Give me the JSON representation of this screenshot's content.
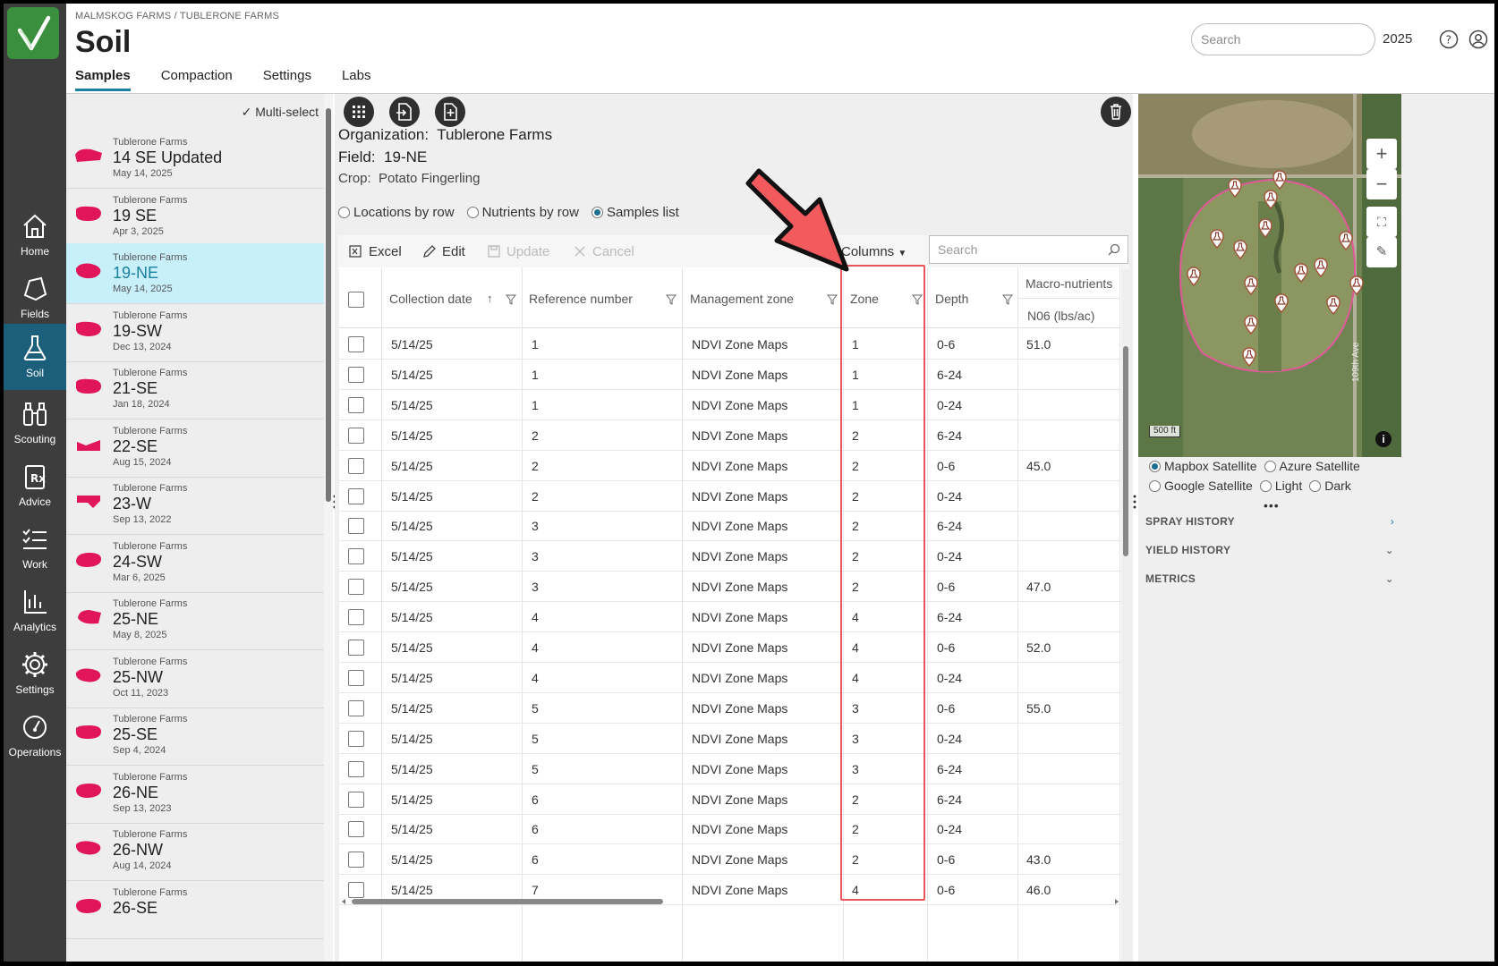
{
  "breadcrumb": "MALMSKOG FARMS / TUBLERONE FARMS",
  "page_title": "Soil",
  "tabs": [
    "Samples",
    "Compaction",
    "Settings",
    "Labs"
  ],
  "header": {
    "search_placeholder": "Search",
    "year": "2025"
  },
  "nav": [
    {
      "label": "Home",
      "icon": "home-icon"
    },
    {
      "label": "Fields",
      "icon": "fields-icon"
    },
    {
      "label": "Soil",
      "icon": "flask-icon"
    },
    {
      "label": "Scouting",
      "icon": "binoculars-icon"
    },
    {
      "label": "Advice",
      "icon": "rx-icon"
    },
    {
      "label": "Work",
      "icon": "checklist-icon"
    },
    {
      "label": "Analytics",
      "icon": "chart-icon"
    },
    {
      "label": "Settings",
      "icon": "gear-icon"
    },
    {
      "label": "Operations",
      "icon": "gauge-icon"
    }
  ],
  "list": {
    "multi_select_label": "Multi-select",
    "items": [
      {
        "org": "Tublerone Farms",
        "name": "14 SE Updated",
        "date": "May 14, 2025"
      },
      {
        "org": "Tublerone Farms",
        "name": "19 SE",
        "date": "Apr 3, 2025"
      },
      {
        "org": "Tublerone Farms",
        "name": "19-NE",
        "date": "May 14, 2025"
      },
      {
        "org": "Tublerone Farms",
        "name": "19-SW",
        "date": "Dec 13, 2024"
      },
      {
        "org": "Tublerone Farms",
        "name": "21-SE",
        "date": "Jan 18, 2024"
      },
      {
        "org": "Tublerone Farms",
        "name": "22-SE",
        "date": "Aug 15, 2024"
      },
      {
        "org": "Tublerone Farms",
        "name": "23-W",
        "date": "Sep 13, 2022"
      },
      {
        "org": "Tublerone Farms",
        "name": "24-SW",
        "date": "Mar 6, 2025"
      },
      {
        "org": "Tublerone Farms",
        "name": "25-NE",
        "date": "May 8, 2025"
      },
      {
        "org": "Tublerone Farms",
        "name": "25-NW",
        "date": "Oct 11, 2023"
      },
      {
        "org": "Tublerone Farms",
        "name": "25-SE",
        "date": "Sep 4, 2024"
      },
      {
        "org": "Tublerone Farms",
        "name": "26-NE",
        "date": "Sep 13, 2023"
      },
      {
        "org": "Tublerone Farms",
        "name": "26-NW",
        "date": "Aug 14, 2024"
      },
      {
        "org": "Tublerone Farms",
        "name": "26-SE",
        "date": ""
      }
    ]
  },
  "details": {
    "organization_label": "Organization:",
    "organization": "Tublerone Farms",
    "field_label": "Field:",
    "field": "19-NE",
    "crop_label": "Crop:",
    "crop": "Potato Fingerling"
  },
  "view_modes": [
    "Locations by row",
    "Nutrients by row",
    "Samples list"
  ],
  "toolbar": {
    "excel": "Excel",
    "edit": "Edit",
    "update": "Update",
    "cancel": "Cancel",
    "columns": "Columns",
    "search_placeholder": "Search"
  },
  "table": {
    "headers": {
      "collection_date": "Collection date",
      "reference_number": "Reference number",
      "management_zone": "Management zone",
      "zone": "Zone",
      "depth": "Depth",
      "macro_group": "Macro-nutrients",
      "n06": "N06 (lbs/ac)"
    },
    "rows": [
      [
        "5/14/25",
        "1",
        "NDVI Zone Maps",
        "1",
        "0-6",
        "51.0"
      ],
      [
        "5/14/25",
        "1",
        "NDVI Zone Maps",
        "1",
        "6-24",
        ""
      ],
      [
        "5/14/25",
        "1",
        "NDVI Zone Maps",
        "1",
        "0-24",
        ""
      ],
      [
        "5/14/25",
        "2",
        "NDVI Zone Maps",
        "2",
        "6-24",
        ""
      ],
      [
        "5/14/25",
        "2",
        "NDVI Zone Maps",
        "2",
        "0-6",
        "45.0"
      ],
      [
        "5/14/25",
        "2",
        "NDVI Zone Maps",
        "2",
        "0-24",
        ""
      ],
      [
        "5/14/25",
        "3",
        "NDVI Zone Maps",
        "2",
        "6-24",
        ""
      ],
      [
        "5/14/25",
        "3",
        "NDVI Zone Maps",
        "2",
        "0-24",
        ""
      ],
      [
        "5/14/25",
        "3",
        "NDVI Zone Maps",
        "2",
        "0-6",
        "47.0"
      ],
      [
        "5/14/25",
        "4",
        "NDVI Zone Maps",
        "4",
        "6-24",
        ""
      ],
      [
        "5/14/25",
        "4",
        "NDVI Zone Maps",
        "4",
        "0-6",
        "52.0"
      ],
      [
        "5/14/25",
        "4",
        "NDVI Zone Maps",
        "4",
        "0-24",
        ""
      ],
      [
        "5/14/25",
        "5",
        "NDVI Zone Maps",
        "3",
        "0-6",
        "55.0"
      ],
      [
        "5/14/25",
        "5",
        "NDVI Zone Maps",
        "3",
        "0-24",
        ""
      ],
      [
        "5/14/25",
        "5",
        "NDVI Zone Maps",
        "3",
        "6-24",
        ""
      ],
      [
        "5/14/25",
        "6",
        "NDVI Zone Maps",
        "2",
        "6-24",
        ""
      ],
      [
        "5/14/25",
        "6",
        "NDVI Zone Maps",
        "2",
        "0-24",
        ""
      ],
      [
        "5/14/25",
        "6",
        "NDVI Zone Maps",
        "2",
        "0-6",
        "43.0"
      ],
      [
        "5/14/25",
        "7",
        "NDVI Zone Maps",
        "4",
        "0-6",
        "46.0"
      ]
    ]
  },
  "map": {
    "scale_label": "500 ft",
    "road_label": "109th Ave",
    "basemaps": [
      "Mapbox Satellite",
      "Azure Satellite",
      "Google Satellite",
      "Light",
      "Dark"
    ],
    "selected_basemap": "Mapbox Satellite"
  },
  "accordion": [
    "SPRAY HISTORY",
    "YIELD HISTORY",
    "METRICS"
  ],
  "colors": {
    "accent": "#1b7fa0",
    "field_shape": "#e0155a",
    "highlight": "#e8555a",
    "rail": "#3d3d3d"
  }
}
